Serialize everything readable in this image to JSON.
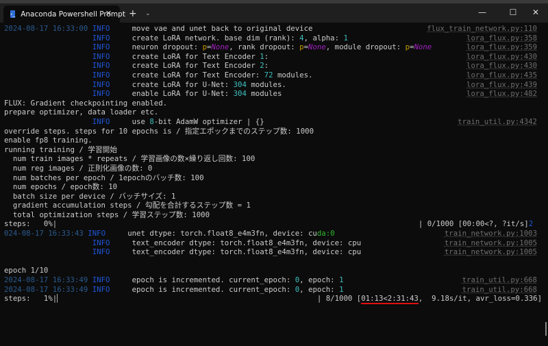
{
  "window": {
    "tab_title": "Anaconda Powershell Prompt",
    "tab_icon": "powershell-icon",
    "new_tab": "+",
    "dropdown": "⌄",
    "close_tab": "✕",
    "minimize": "—",
    "maximize": "☐",
    "close": "✕"
  },
  "lines": [
    {
      "segs": [
        {
          "t": "2024-08-17 16:33:00 ",
          "c": "ts"
        },
        {
          "t": "INFO",
          "c": "info"
        },
        {
          "t": "     move vae and unet back to original device",
          "c": ""
        }
      ],
      "file": "flux_train_network.py:110"
    },
    {
      "segs": [
        {
          "t": "                    ",
          "c": ""
        },
        {
          "t": "INFO",
          "c": "info"
        },
        {
          "t": "     create LoRA network. base dim (rank): ",
          "c": ""
        },
        {
          "t": "4",
          "c": "num"
        },
        {
          "t": ", alpha: ",
          "c": ""
        },
        {
          "t": "1",
          "c": "num"
        }
      ],
      "file": "lora_flux.py:358"
    },
    {
      "segs": [
        {
          "t": "                    ",
          "c": ""
        },
        {
          "t": "INFO",
          "c": "info"
        },
        {
          "t": "     neuron dropout: ",
          "c": ""
        },
        {
          "t": "p",
          "c": "p"
        },
        {
          "t": "=",
          "c": ""
        },
        {
          "t": "None",
          "c": "none"
        },
        {
          "t": ", rank dropout: ",
          "c": ""
        },
        {
          "t": "p",
          "c": "p"
        },
        {
          "t": "=",
          "c": ""
        },
        {
          "t": "None",
          "c": "none"
        },
        {
          "t": ", module dropout: ",
          "c": ""
        },
        {
          "t": "p",
          "c": "p"
        },
        {
          "t": "=",
          "c": ""
        },
        {
          "t": "None",
          "c": "none"
        }
      ],
      "file": "lora_flux.py:359"
    },
    {
      "segs": [
        {
          "t": "                    ",
          "c": ""
        },
        {
          "t": "INFO",
          "c": "info"
        },
        {
          "t": "     create LoRA for Text Encoder ",
          "c": ""
        },
        {
          "t": "1",
          "c": "num"
        },
        {
          "t": ":",
          "c": ""
        }
      ],
      "file": "lora_flux.py:430"
    },
    {
      "segs": [
        {
          "t": "                    ",
          "c": ""
        },
        {
          "t": "INFO",
          "c": "info"
        },
        {
          "t": "     create LoRA for Text Encoder ",
          "c": ""
        },
        {
          "t": "2",
          "c": "num"
        },
        {
          "t": ":",
          "c": ""
        }
      ],
      "file": "lora_flux.py:430"
    },
    {
      "segs": [
        {
          "t": "                    ",
          "c": ""
        },
        {
          "t": "INFO",
          "c": "info"
        },
        {
          "t": "     create LoRA for Text Encoder: ",
          "c": ""
        },
        {
          "t": "72",
          "c": "num"
        },
        {
          "t": " modules.",
          "c": ""
        }
      ],
      "file": "lora_flux.py:435"
    },
    {
      "segs": [
        {
          "t": "                    ",
          "c": ""
        },
        {
          "t": "INFO",
          "c": "info"
        },
        {
          "t": "     create LoRA for U-Net: ",
          "c": ""
        },
        {
          "t": "304",
          "c": "num"
        },
        {
          "t": " modules.",
          "c": ""
        }
      ],
      "file": "lora_flux.py:439"
    },
    {
      "segs": [
        {
          "t": "                    ",
          "c": ""
        },
        {
          "t": "INFO",
          "c": "info"
        },
        {
          "t": "     enable LoRA for U-Net: ",
          "c": ""
        },
        {
          "t": "304",
          "c": "num"
        },
        {
          "t": " modules",
          "c": ""
        }
      ],
      "file": "lora_flux.py:482"
    },
    {
      "segs": [
        {
          "t": "FLUX: Gradient checkpointing enabled.",
          "c": ""
        }
      ]
    },
    {
      "segs": [
        {
          "t": "prepare optimizer, data loader etc.",
          "c": ""
        }
      ]
    },
    {
      "segs": [
        {
          "t": "                    ",
          "c": ""
        },
        {
          "t": "INFO",
          "c": "info"
        },
        {
          "t": "     use ",
          "c": ""
        },
        {
          "t": "8",
          "c": "num"
        },
        {
          "t": "-bit AdamW optimizer | {}",
          "c": ""
        }
      ],
      "file": "train_util.py:4342"
    },
    {
      "segs": [
        {
          "t": "override steps. steps for 10 epochs is / 指定エポックまでのステップ数: 1000",
          "c": ""
        }
      ]
    },
    {
      "segs": [
        {
          "t": "enable fp8 training.",
          "c": ""
        }
      ]
    },
    {
      "segs": [
        {
          "t": "running training / 学習開始",
          "c": ""
        }
      ]
    },
    {
      "segs": [
        {
          "t": "  num train images * repeats / 学習画像の数×繰り返し回数: 100",
          "c": ""
        }
      ]
    },
    {
      "segs": [
        {
          "t": "  num reg images / 正則化画像の数: 0",
          "c": ""
        }
      ]
    },
    {
      "segs": [
        {
          "t": "  num batches per epoch / 1epochのバッチ数: 100",
          "c": ""
        }
      ]
    },
    {
      "segs": [
        {
          "t": "  num epochs / epoch数: 10",
          "c": ""
        }
      ]
    },
    {
      "segs": [
        {
          "t": "  batch size per device / バッチサイズ: 1",
          "c": ""
        }
      ]
    },
    {
      "segs": [
        {
          "t": "  gradient accumulation steps / 勾配を合計するステップ数 = 1",
          "c": ""
        }
      ]
    },
    {
      "segs": [
        {
          "t": "  total optimization steps / 学習ステップ数: 1000",
          "c": ""
        }
      ]
    },
    {
      "segs": [
        {
          "t": "steps:   0%|                                                                                  | 0/1000 [00:00<?, ?it/s]",
          "c": ""
        },
        {
          "t": "2",
          "c": "info"
        }
      ]
    },
    {
      "segs": [
        {
          "t": "024-08-17 16:33:43 ",
          "c": "ts"
        },
        {
          "t": "INFO",
          "c": "info"
        },
        {
          "t": "     unet dtype: torch.float8_e4m3fn, device: cu",
          "c": ""
        },
        {
          "t": "da:0",
          "c": "green"
        }
      ],
      "file": "train_network.py:1003"
    },
    {
      "segs": [
        {
          "t": "                    ",
          "c": ""
        },
        {
          "t": "INFO",
          "c": "info"
        },
        {
          "t": "     text_encoder dtype: torch.float8_e4m3fn, device: cpu",
          "c": ""
        }
      ],
      "file": "train_network.py:1005"
    },
    {
      "segs": [
        {
          "t": "                    ",
          "c": ""
        },
        {
          "t": "INFO",
          "c": "info"
        },
        {
          "t": "     text_encoder dtype: torch.float8_e4m3fn, device: cpu",
          "c": ""
        }
      ],
      "file": "train_network.py:1005"
    },
    {
      "segs": [
        {
          "t": " ",
          "c": ""
        }
      ]
    },
    {
      "segs": [
        {
          "t": "epoch 1/10",
          "c": ""
        }
      ]
    },
    {
      "segs": [
        {
          "t": "2024-08-17 16:33:49 ",
          "c": "ts"
        },
        {
          "t": "INFO",
          "c": "info"
        },
        {
          "t": "     epoch is incremented. current_epoch: ",
          "c": ""
        },
        {
          "t": "0",
          "c": "num"
        },
        {
          "t": ", epoch: ",
          "c": ""
        },
        {
          "t": "1",
          "c": "num"
        }
      ],
      "file": "train_util.py:668"
    },
    {
      "segs": [
        {
          "t": "2024-08-17 16:33:49 ",
          "c": "ts"
        },
        {
          "t": "INFO",
          "c": "info"
        },
        {
          "t": "     epoch is incremented. current_epoch: ",
          "c": ""
        },
        {
          "t": "0",
          "c": "num"
        },
        {
          "t": ", epoch: ",
          "c": ""
        },
        {
          "t": "1",
          "c": "num"
        }
      ],
      "file": "train_util.py:668"
    },
    {
      "segs": [
        {
          "t": "steps:   1%|▏                                                          | 8/1000 [",
          "c": ""
        },
        {
          "t": "01:13<2:31:43",
          "c": "ul"
        },
        {
          "t": ",  9.18s/it, avr_loss=0.336]",
          "c": ""
        }
      ]
    }
  ]
}
